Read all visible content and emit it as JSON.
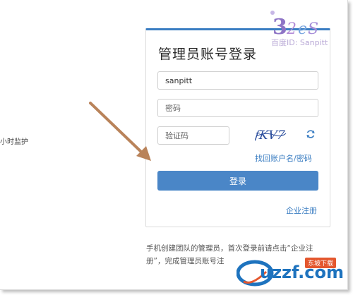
{
  "left_text": "小时监护",
  "login": {
    "title": "管理员账号登录",
    "username_value": "sanpitt",
    "password_placeholder": "密码",
    "captcha_placeholder": "验证码",
    "captcha_text": "fKV7",
    "forgot_link": "找回账户名/密码",
    "login_button": "登录",
    "register_link": "企业注册"
  },
  "note": "手机创建团队的管理员，首次登录前请点击“企业注册”，完成管理员账号注",
  "watermarks": {
    "top_text": "百度ID: Sanpitt",
    "brand": "uzzf.com",
    "badge": "东坡下载"
  },
  "colors": {
    "accent": "#3a7dc2",
    "button": "#4a86c7",
    "arrow": "#b9835a"
  }
}
